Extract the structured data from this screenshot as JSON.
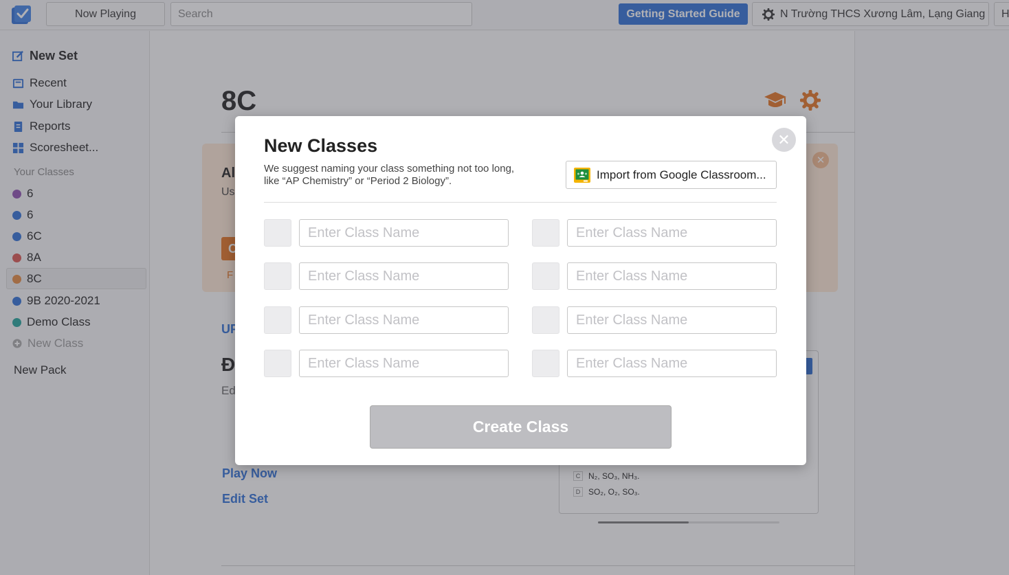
{
  "topbar": {
    "now_playing": "Now Playing",
    "search_placeholder": "Search",
    "guide_button": "Getting Started Guide",
    "school_button": "N Trường THCS Xương Lâm, Lạng Giang",
    "help_button": "H",
    "accent_color": "#2d6fd6"
  },
  "sidebar": {
    "new_set": "New Set",
    "nav": [
      {
        "label": "Recent",
        "icon": "recent-icon"
      },
      {
        "label": "Your Library",
        "icon": "folder-icon"
      },
      {
        "label": "Reports",
        "icon": "reports-icon"
      },
      {
        "label": "Scoresheet...",
        "icon": "scoresheet-icon"
      }
    ],
    "section_label": "Your Classes",
    "classes": [
      {
        "label": "6",
        "color": "#8e4fb0"
      },
      {
        "label": "6",
        "color": "#2d6fd6"
      },
      {
        "label": "6C",
        "color": "#2d6fd6"
      },
      {
        "label": "8A",
        "color": "#d9534f"
      },
      {
        "label": "8C",
        "color": "#e4893f",
        "selected": true
      },
      {
        "label": "9B 2020-2021",
        "color": "#2d6fd6"
      },
      {
        "label": "Demo Class",
        "color": "#1fa39a"
      }
    ],
    "new_class": "New Class",
    "new_pack": "New Pack"
  },
  "main": {
    "class_title": "8C",
    "banner_title": "Al",
    "banner_sub": "Us",
    "banner_button": "C",
    "banner_link": "F",
    "section_heading": "UP",
    "set_title": "Đ",
    "set_sub": "Ed",
    "play_now": "Play Now",
    "edit_set": "Edit Set",
    "preview_answers": [
      {
        "letter": "C",
        "text": "N₂, SO₃, NH₃."
      },
      {
        "letter": "D",
        "text": "SO₂, O₂, SO₃."
      }
    ]
  },
  "modal": {
    "title": "New Classes",
    "description": "We suggest naming your class something not too long, like “AP Chemistry” or “Period 2 Biology”.",
    "import_button": "Import from Google Classroom...",
    "class_name_placeholder": "Enter Class Name",
    "create_button": "Create Class",
    "close_glyph": "✕"
  }
}
